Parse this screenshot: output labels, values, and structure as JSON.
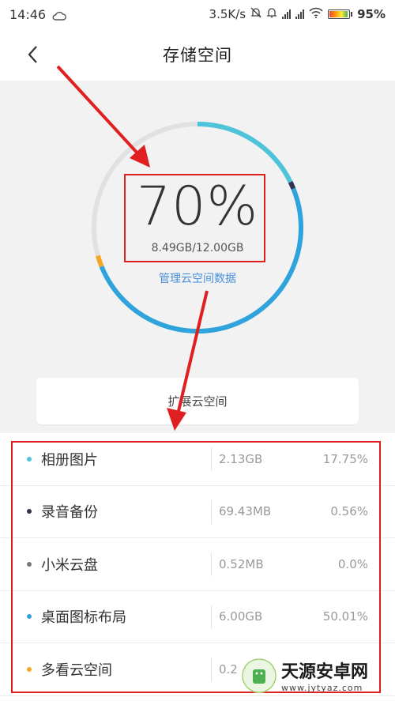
{
  "status_bar": {
    "time": "14:46",
    "speed": "3.5K/s",
    "battery": "95%",
    "battery_level": 0.95
  },
  "header": {
    "title": "存储空间"
  },
  "storage": {
    "percent": "70%",
    "usage": "8.49GB/12.00GB",
    "manage_link": "管理云空间数据",
    "expand_button": "扩展云空间",
    "used_fraction": 0.7
  },
  "categories": [
    {
      "name": "相册图片",
      "size": "2.13GB",
      "share": "17.75%",
      "color": "#4fc3d9",
      "fraction": 0.1775
    },
    {
      "name": "录音备份",
      "size": "69.43MB",
      "share": "0.56%",
      "color": "#2f3350",
      "fraction": 0.0056
    },
    {
      "name": "小米云盘",
      "size": "0.52MB",
      "share": "0.0%",
      "color": "#777777",
      "fraction": 0.0
    },
    {
      "name": "桌面图标布局",
      "size": "6.00GB",
      "share": "50.01%",
      "color": "#2ea3dc",
      "fraction": 0.5001
    },
    {
      "name": "多看云空间",
      "size": "0.2",
      "share": "",
      "color": "#f5a623",
      "fraction": 0.0175
    }
  ],
  "colors": {
    "annotation_red": "#e02020",
    "ring_track": "#e1e1e1",
    "link_blue": "#4a90d9"
  },
  "watermark": {
    "brand": "天源安卓网",
    "url": "www.jytyaz.com"
  },
  "icons": [
    "back-arrow-icon",
    "cloud-icon",
    "mute-bell-icon",
    "alarm-bell-icon",
    "signal-icon",
    "wifi-icon",
    "battery-icon"
  ]
}
